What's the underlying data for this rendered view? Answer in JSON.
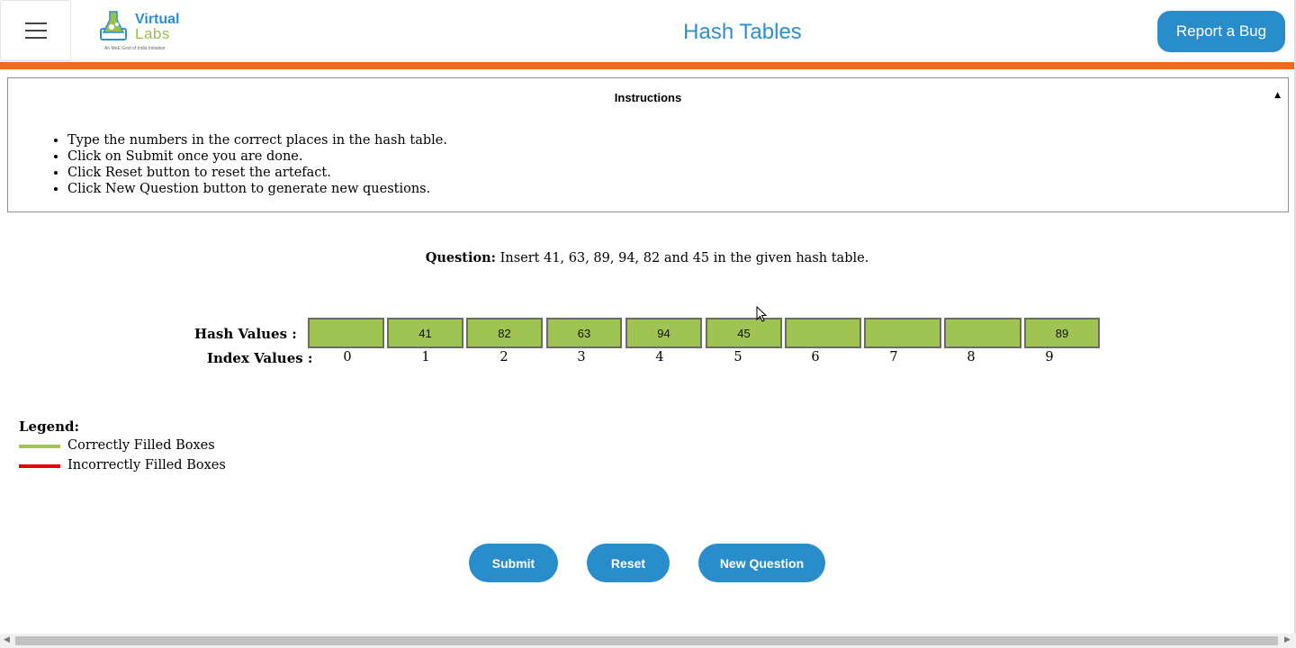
{
  "header": {
    "logo_line1": "Virtual",
    "logo_line2": "Labs",
    "logo_tagline": "An MoE Govt of India Initiative",
    "title": "Hash Tables",
    "report_bug_label": "Report a Bug"
  },
  "instructions": {
    "title": "Instructions",
    "toggle": "▲",
    "items": [
      "Type the numbers in the correct places in the hash table.",
      "Click on Submit once you are done.",
      "Click Reset button to reset the artefact.",
      "Click New Question button to generate new questions."
    ]
  },
  "question": {
    "label": "Question:",
    "text": "Insert 41, 63, 89, 94, 82 and 45 in the given hash table."
  },
  "hash_table": {
    "hash_label": "Hash Values :",
    "index_label": "Index Values :",
    "cells": [
      "",
      "41",
      "82",
      "63",
      "94",
      "45",
      "",
      "",
      "",
      "89"
    ],
    "indices": [
      "0",
      "1",
      "2",
      "3",
      "4",
      "5",
      "6",
      "7",
      "8",
      "9"
    ],
    "cell_color": "#a0c453"
  },
  "legend": {
    "title": "Legend:",
    "correct_label": "Correctly Filled Boxes",
    "correct_color": "#a0c453",
    "incorrect_label": "Incorrectly Filled Boxes",
    "incorrect_color": "#e60000"
  },
  "buttons": {
    "submit": "Submit",
    "reset": "Reset",
    "new_question": "New Question"
  },
  "colors": {
    "accent": "#2a8dcb",
    "header_bar": "#f56a12"
  }
}
